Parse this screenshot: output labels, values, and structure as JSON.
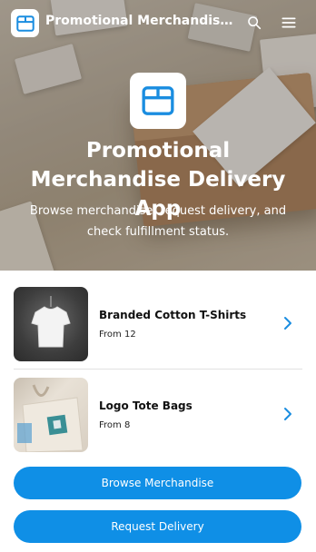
{
  "header": {
    "app_title": "Promotional Merchandise Deli...",
    "icons": {
      "app": "box-icon",
      "search": "search-icon",
      "menu": "hamburger-menu-icon"
    }
  },
  "hero": {
    "title": "Promotional Merchandise Delivery App",
    "subtitle": "Browse merchandise, request delivery, and check fulfillment status."
  },
  "products": [
    {
      "name": "Branded Cotton T-Shirts",
      "price": "From 12",
      "icon": "chevron-right-icon"
    },
    {
      "name": "Logo Tote Bags",
      "price": "From 8",
      "icon": "chevron-right-icon"
    }
  ],
  "actions": {
    "browse_label": "Browse Merchandise",
    "request_label": "Request Delivery"
  },
  "colors": {
    "accent": "#0f8fe6",
    "icon_blue": "#1a8de0",
    "white": "#ffffff"
  }
}
